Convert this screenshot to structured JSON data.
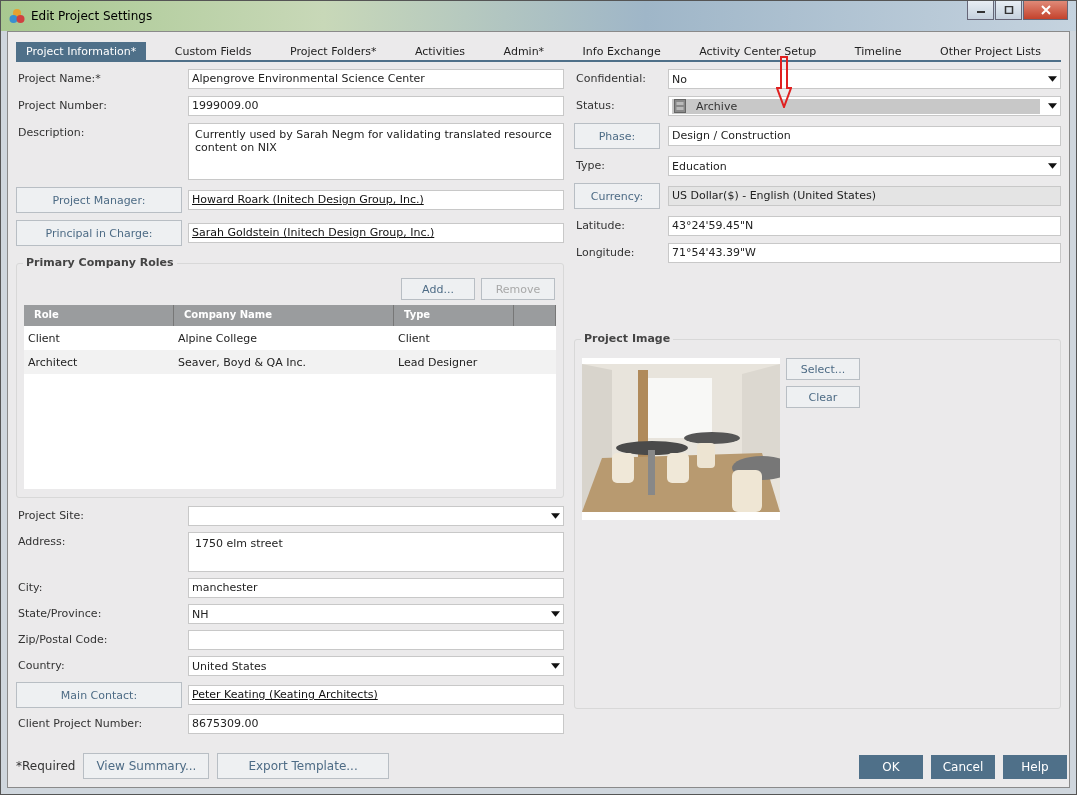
{
  "window": {
    "title": "Edit Project Settings"
  },
  "tabs": [
    {
      "label": "Project Information*",
      "selected": true
    },
    {
      "label": "Custom Fields",
      "selected": false
    },
    {
      "label": "Project Folders*",
      "selected": false
    },
    {
      "label": "Activities",
      "selected": false
    },
    {
      "label": "Admin*",
      "selected": false
    },
    {
      "label": "Info Exchange",
      "selected": false
    },
    {
      "label": "Activity Center Setup",
      "selected": false
    },
    {
      "label": "Timeline",
      "selected": false
    },
    {
      "label": "Other Project Lists",
      "selected": false
    }
  ],
  "project_fields": [
    {
      "kind": "text",
      "label": "Project Name:*",
      "value": "Alpengrove Environmental Science Center"
    },
    {
      "kind": "text",
      "label": "Project Number:",
      "value": "1999009.00"
    },
    {
      "kind": "textarea",
      "label": "Description:",
      "value": "Currently used by Sarah Negm for validating translated resource content on NIX"
    },
    {
      "kind": "person",
      "label": "Project Manager:",
      "value": "Howard Roark (Initech Design Group, Inc.)"
    },
    {
      "kind": "person",
      "label": "Principal in Charge:",
      "value": "Sarah Goldstein (Initech Design Group, Inc.)"
    }
  ],
  "company_roles": {
    "title": "Primary Company Roles",
    "add_button": {
      "label": "Add...",
      "disabled": false
    },
    "remove_button": {
      "label": "Remove",
      "disabled": true
    },
    "columns": [
      "Role",
      "Company Name",
      "Type"
    ],
    "rows": [
      {
        "cells": [
          "Client",
          "Alpine College",
          "Client"
        ]
      },
      {
        "cells": [
          "Architect",
          "Seaver, Boyd & QA Inc.",
          "Lead Designer"
        ]
      }
    ]
  },
  "site_fields": [
    {
      "kind": "select",
      "label": "Project Site:"
    },
    {
      "kind": "textarea",
      "label": "Address:",
      "value": "1750 elm street"
    },
    {
      "kind": "text",
      "label": "City:",
      "value": "manchester"
    },
    {
      "kind": "select",
      "label": "State/Province:",
      "value": "NH"
    },
    {
      "kind": "text",
      "label": "Zip/Postal Code:"
    },
    {
      "kind": "select",
      "label": "Country:",
      "value": "United States"
    },
    {
      "kind": "person",
      "label": "Main Contact:",
      "value": "Peter Keating (Keating Architects)"
    },
    {
      "kind": "text",
      "label": "Client Project Number:",
      "value": "8675309.00"
    }
  ],
  "right_fields": [
    {
      "kind": "select",
      "label": "Confidential:",
      "value": "No"
    },
    {
      "kind": "status",
      "label": "Status:",
      "value": "Archive"
    },
    {
      "kind": "button_text",
      "label": "Phase:",
      "value": "Design / Construction"
    },
    {
      "kind": "select",
      "label": "Type:",
      "value": "Education"
    },
    {
      "kind": "button_readonly",
      "label": "Currency:",
      "value": "US Dollar($) - English (United States)"
    },
    {
      "kind": "text",
      "label": "Latitude:",
      "value": "43°24'59.45\"N"
    },
    {
      "kind": "text",
      "label": "Longitude:",
      "value": "71°54'43.39\"W"
    }
  ],
  "project_image": {
    "title": "Project Image",
    "image": {
      "kind": "picture"
    },
    "buttons": [
      "Select...",
      "Clear"
    ]
  },
  "footer": {
    "note": "*Required",
    "buttons": [
      "View Summary...",
      "Export Template..."
    ]
  },
  "dialog_buttons": [
    "OK",
    "Cancel",
    "Help"
  ]
}
